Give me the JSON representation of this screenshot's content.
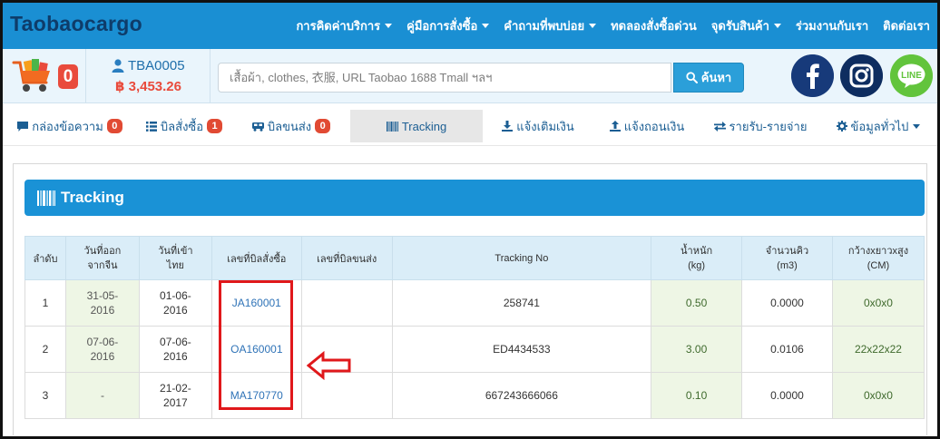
{
  "brand": "Taobaocargo",
  "topnav": [
    {
      "label": "การคิดค่าบริการ",
      "caret": true
    },
    {
      "label": "คู่มือการสั่งซื้อ",
      "caret": true
    },
    {
      "label": "คำถามที่พบบ่อย",
      "caret": true
    },
    {
      "label": "ทดลองสั่งซื้อด่วน",
      "caret": false
    },
    {
      "label": "จุดรับสินค้า",
      "caret": true
    },
    {
      "label": "ร่วมงานกับเรา",
      "caret": false
    },
    {
      "label": "ติดต่อเรา",
      "caret": false
    }
  ],
  "cart": {
    "count": "0"
  },
  "user": {
    "id": "TBA0005",
    "balance": "฿ 3,453.26"
  },
  "search": {
    "placeholder": "เสื้อผ้า, clothes, 衣服, URL Taobao 1688 Tmall ฯลฯ",
    "button_label": "ค้นหา"
  },
  "tabs": [
    {
      "label": "กล่องข้อความ",
      "badge": "0"
    },
    {
      "label": "บิลสั่งซื้อ",
      "badge": "1"
    },
    {
      "label": "บิลขนส่ง",
      "badge": "0"
    },
    {
      "label": "Tracking",
      "badge": ""
    },
    {
      "label": "แจ้งเติมเงิน",
      "badge": ""
    },
    {
      "label": "แจ้งถอนเงิน",
      "badge": ""
    },
    {
      "label": "รายรับ-รายจ่าย",
      "badge": ""
    },
    {
      "label": "ข้อมูลทั่วไป",
      "badge": ""
    }
  ],
  "panel": {
    "title": "Tracking"
  },
  "table": {
    "headers": [
      "ลำดับ",
      "วันที่ออกจากจีน",
      "วันที่เข้าไทย",
      "เลขที่บิลสั่งซื้อ",
      "เลขที่บิลขนส่ง",
      "Tracking No",
      "น้ำหนัก (kg)",
      "จำนวนคิว (m3)",
      "กว้างxยาวxสูง (CM)"
    ],
    "rows": [
      {
        "no": "1",
        "out_cn": "31-05-2016",
        "in_th": "01-06-2016",
        "order_bill": "JA160001",
        "ship_bill": "",
        "tracking": "258741",
        "weight": "0.50",
        "cbm": "0.0000",
        "dims": "0x0x0"
      },
      {
        "no": "2",
        "out_cn": "07-06-2016",
        "in_th": "07-06-2016",
        "order_bill": "OA160001",
        "ship_bill": "",
        "tracking": "ED4434533",
        "weight": "3.00",
        "cbm": "0.0106",
        "dims": "22x22x22"
      },
      {
        "no": "3",
        "out_cn": "-",
        "in_th": "21-02-2017",
        "order_bill": "MA170770",
        "ship_bill": "",
        "tracking": "667243666066",
        "weight": "0.10",
        "cbm": "0.0000",
        "dims": "0x0x0"
      }
    ]
  },
  "colors": {
    "brand_blue": "#1a8fd3",
    "badge_red": "#e14a33",
    "annotation_red": "#e0181b"
  }
}
